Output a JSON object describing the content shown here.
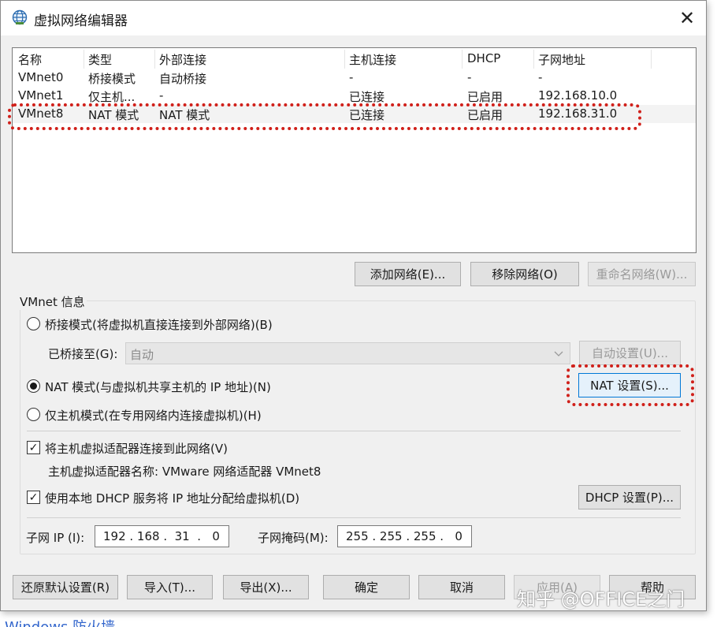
{
  "window": {
    "title": "虚拟网络编辑器",
    "icon": "globe-icon",
    "close_glyph": "✕"
  },
  "network_table": {
    "columns": [
      "名称",
      "类型",
      "外部连接",
      "主机连接",
      "DHCP",
      "子网地址"
    ],
    "rows": [
      [
        "VMnet0",
        "桥接模式",
        "自动桥接",
        "-",
        "-",
        "-"
      ],
      [
        "VMnet1",
        "仅主机...",
        "-",
        "已连接",
        "已启用",
        "192.168.10.0"
      ],
      [
        "VMnet8",
        "NAT 模式",
        "NAT 模式",
        "已连接",
        "已启用",
        "192.168.31.0"
      ]
    ]
  },
  "list_buttons": {
    "add": "添加网络(E)...",
    "remove": "移除网络(O)",
    "rename": "重命名网络(W)..."
  },
  "vmnet_info": {
    "group_title": "VMnet 信息",
    "bridged_label": "桥接模式(将虚拟机直接连接到外部网络)(B)",
    "bridged_to_label": "已桥接至(G):",
    "bridged_to_value": "自动",
    "auto_settings": "自动设置(U)...",
    "nat_label": "NAT 模式(与虚拟机共享主机的 IP 地址)(N)",
    "nat_settings": "NAT 设置(S)...",
    "hostonly_label": "仅主机模式(在专用网络内连接虚拟机)(H)",
    "connect_adapter_label": "将主机虚拟适配器连接到此网络(V)",
    "adapter_name_text": "主机虚拟适配器名称: VMware 网络适配器 VMnet8",
    "dhcp_label": "使用本地 DHCP 服务将 IP 地址分配给虚拟机(D)",
    "dhcp_settings": "DHCP 设置(P)...",
    "subnet_ip_label": "子网 IP (I):",
    "subnet_ip_value": "192 . 168 .  31  .   0",
    "subnet_mask_label": "子网掩码(M):",
    "subnet_mask_value": "255 . 255 . 255 .   0",
    "checkmark": "✓"
  },
  "footer_buttons": {
    "restore": "还原默认设置(R)",
    "import": "导入(T)...",
    "export": "导出(X)...",
    "ok": "确定",
    "cancel": "取消",
    "apply": "应用(A)",
    "help": "帮助"
  },
  "watermark": "知乎 @OFFICE之门",
  "below_window_text": "Windows  防火墙",
  "colors": {
    "highlight": "#d0201a",
    "window_bg": "#f0f0f0",
    "button_bg": "#e1e1e1"
  }
}
